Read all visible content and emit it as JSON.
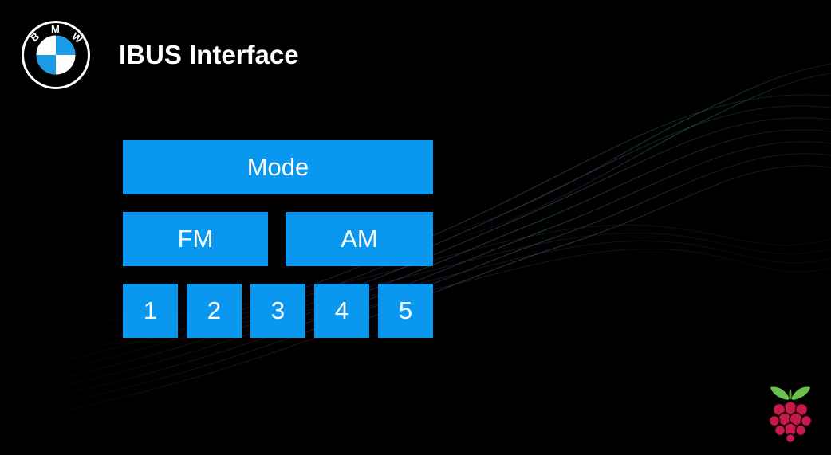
{
  "header": {
    "title": "IBUS Interface",
    "logo_icon": "bmw-logo-icon",
    "logo_letters": "BMW"
  },
  "controls": {
    "mode_label": "Mode",
    "band_buttons": [
      "FM",
      "AM"
    ],
    "preset_buttons": [
      "1",
      "2",
      "3",
      "4",
      "5"
    ]
  },
  "footer": {
    "logo_icon": "raspberry-pi-logo-icon"
  },
  "colors": {
    "background": "#000000",
    "button": "#0a97f0",
    "button_text": "#ffffff",
    "title_text": "#ffffff",
    "bmw_blue": "#1c9be6",
    "raspberry_red": "#c51a4a",
    "raspberry_leaf": "#6cc04a"
  }
}
